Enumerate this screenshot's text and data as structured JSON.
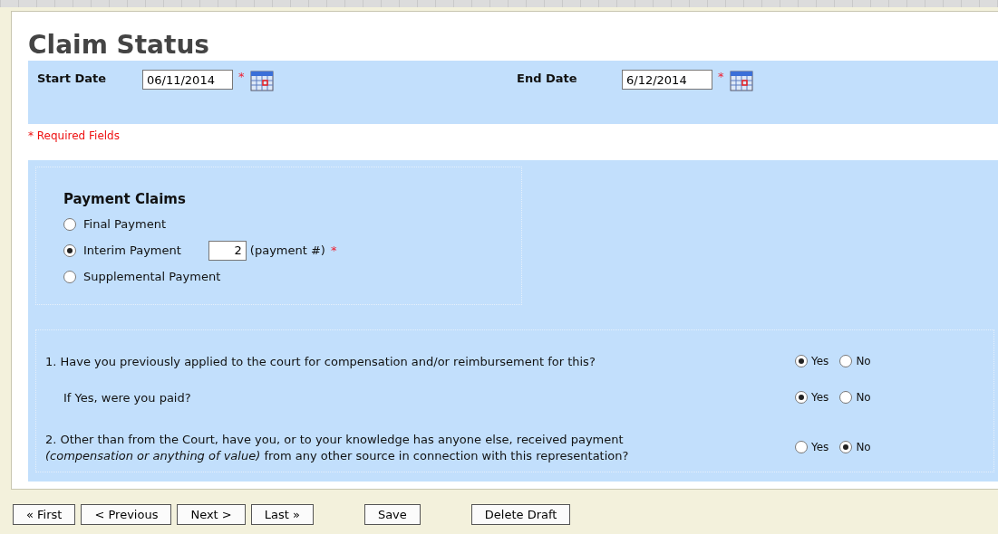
{
  "title": "Claim Status",
  "date_range": [
    {
      "label": "Start Date",
      "value": "06/11/2014",
      "required_mark": "*"
    },
    {
      "label": "End Date",
      "value": "6/12/2014",
      "required_mark": "*"
    }
  ],
  "required_note": "* Required Fields",
  "payment_claims": {
    "heading": "Payment Claims",
    "options": [
      {
        "label": "Final Payment",
        "selected": false
      },
      {
        "label": "Interim Payment",
        "selected": true
      },
      {
        "label": "Supplemental Payment",
        "selected": false
      }
    ],
    "payment_number": {
      "value": "2",
      "suffix": "(payment #)",
      "required_mark": "*"
    }
  },
  "questions": [
    {
      "lines": [
        "1. Have you previously applied to the court for compensation and/or reimbursement for this?"
      ],
      "answers": [
        {
          "label": "Yes",
          "selected": true
        },
        {
          "label": "No",
          "selected": false
        }
      ],
      "children": [
        {
          "lines": [
            "If Yes, were you paid?"
          ],
          "answers": [
            {
              "label": "Yes",
              "selected": true
            },
            {
              "label": "No",
              "selected": false
            }
          ]
        }
      ]
    },
    {
      "lines": [
        "2. Other than from the Court, have you, or to your knowledge has anyone else, received payment",
        "*(compensation or anything of value)* from any other source in connection with this representation?"
      ],
      "answers": [
        {
          "label": "Yes",
          "selected": false
        },
        {
          "label": "No",
          "selected": true
        }
      ]
    }
  ],
  "buttons": [
    "« First",
    "< Previous",
    "Next >",
    "Last »",
    "Save",
    "Delete Draft"
  ]
}
